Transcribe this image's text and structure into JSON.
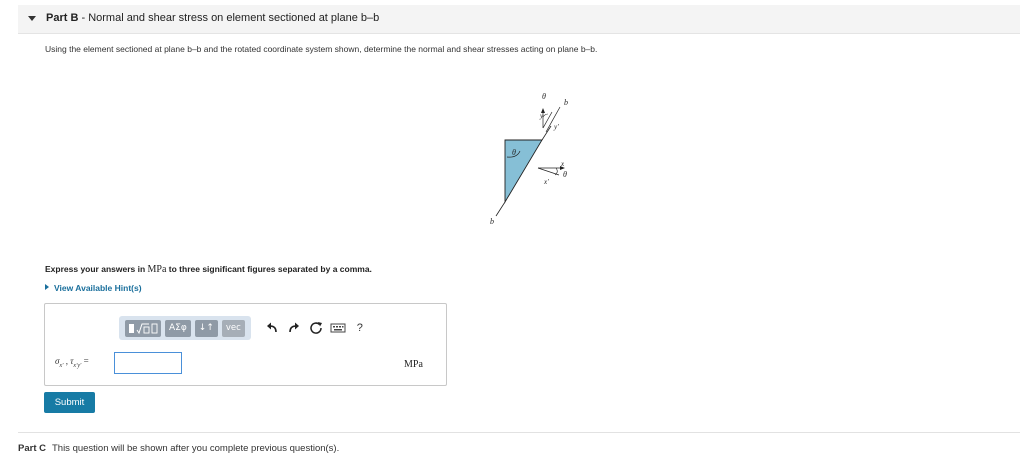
{
  "part_b": {
    "label": "Part B",
    "separator": " - ",
    "title": "Normal and shear stress on element sectioned at plane b–b"
  },
  "question": "Using the element sectioned at plane b–b and the rotated coordinate system shown, determine the normal and shear stresses acting on plane b–b.",
  "figure": {
    "theta_top": "θ",
    "b_top": "b",
    "y_label": "y",
    "y_prime_label": "y′",
    "theta_element": "θ",
    "x_label": "x",
    "x_prime_label": "x′",
    "theta_right": "θ",
    "b_bottom": "b",
    "fill_color": "#86bfd6"
  },
  "instruction": {
    "before": "Express your answers in ",
    "unit": "MPa",
    "after": " to three significant figures separated by a comma."
  },
  "hint_link": "View Available Hint(s)",
  "toolbar": {
    "templates_icon": "templates-icon",
    "greek": "ΑΣφ",
    "subscript": "↓↑",
    "vec": "vec",
    "undo_icon": "undo-icon",
    "redo_icon": "redo-icon",
    "reset_icon": "reset-icon",
    "keyboard_icon": "keyboard-icon",
    "help": "?"
  },
  "answer": {
    "variable_label": "σx′ , τx′y′ =",
    "value": "",
    "unit": "MPa"
  },
  "submit_label": "Submit",
  "part_c": {
    "label": "Part C",
    "text": "This question will be shown after you complete previous question(s)."
  },
  "colors": {
    "accent": "#177ba5",
    "link": "#1a6f9c",
    "toolbar_bg": "#d9e3ee",
    "input_border": "#4a90d9"
  }
}
